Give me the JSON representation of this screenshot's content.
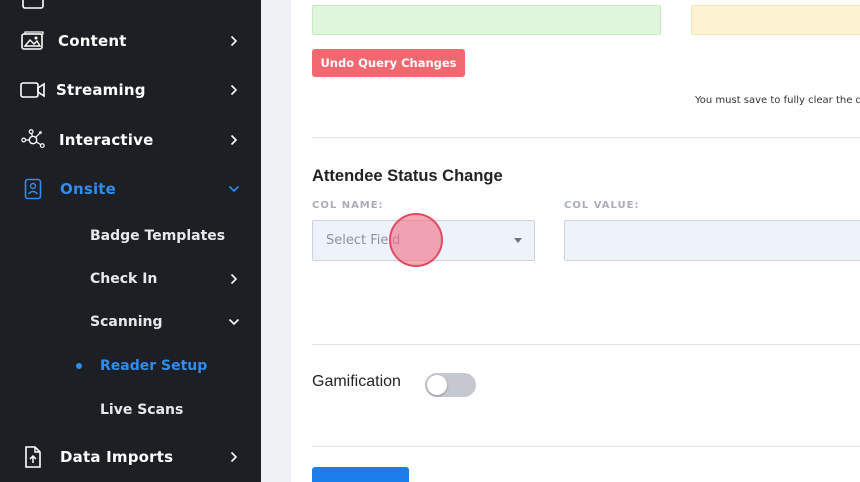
{
  "sidebar": {
    "items": [
      {
        "label": "Content",
        "icon": "image-icon"
      },
      {
        "label": "Streaming",
        "icon": "video-camera-icon"
      },
      {
        "label": "Interactive",
        "icon": "network-nodes-icon"
      },
      {
        "label": "Onsite",
        "icon": "badge-id-icon",
        "active": true
      },
      {
        "label": "Data Imports",
        "icon": "file-import-icon"
      }
    ],
    "sub_items": [
      {
        "label": "Badge Templates"
      },
      {
        "label": "Check In"
      },
      {
        "label": "Scanning"
      },
      {
        "label": "Reader Setup",
        "active": true
      },
      {
        "label": "Live Scans"
      }
    ]
  },
  "main": {
    "undo_button": "Undo Query Changes",
    "hint": "You must save to fully clear the quer",
    "attendee_section": {
      "title": "Attendee Status Change",
      "col_name_label": "COL NAME:",
      "col_value_label": "COL VALUE:",
      "select_placeholder": "Select Field"
    },
    "gamification": {
      "label": "Gamification",
      "enabled": false
    }
  },
  "colors": {
    "sidebar_bg": "#1c1f23",
    "accent": "#2f8cf0",
    "undo_button": "#f26870",
    "primary_button": "#1a7de8"
  }
}
